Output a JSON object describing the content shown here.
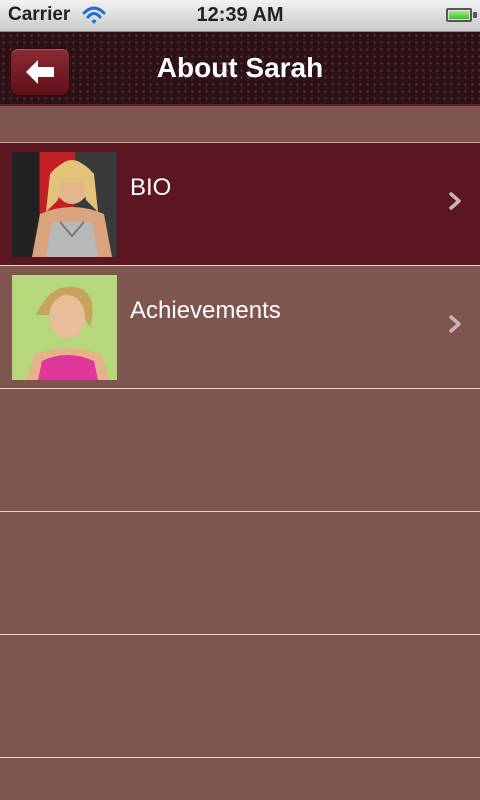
{
  "status_bar": {
    "carrier": "Carrier",
    "time": "12:39 AM",
    "wifi_icon": "wifi-icon",
    "battery_icon": "battery-icon"
  },
  "nav_bar": {
    "title": "About Sarah",
    "back_icon": "back-arrow-icon"
  },
  "list": {
    "items": [
      {
        "label": "BIO",
        "selected": true,
        "thumbnail_icon": "bio-photo-icon"
      },
      {
        "label": "Achievements",
        "selected": false,
        "thumbnail_icon": "achievements-photo-icon"
      }
    ]
  },
  "colors": {
    "background": "#7f5550",
    "selected_row": "#5b1621",
    "nav_bar": "#2a1216",
    "back_button": "#7a1f2a"
  }
}
